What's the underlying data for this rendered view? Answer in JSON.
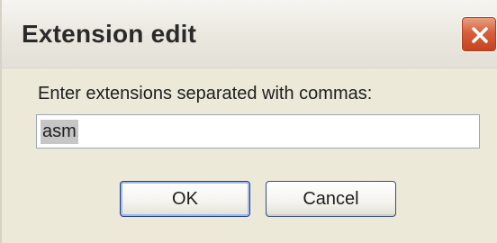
{
  "dialog": {
    "title": "Extension edit",
    "close_icon": "close-x-icon",
    "prompt": "Enter extensions separated with commas:",
    "input_value": "asm",
    "ok_label": "OK",
    "cancel_label": "Cancel"
  },
  "colors": {
    "window_background": "#ece9d8",
    "close_button": "#d6603c",
    "selection": "#c6c6c6",
    "default_button_border": "#1d3f8c"
  }
}
